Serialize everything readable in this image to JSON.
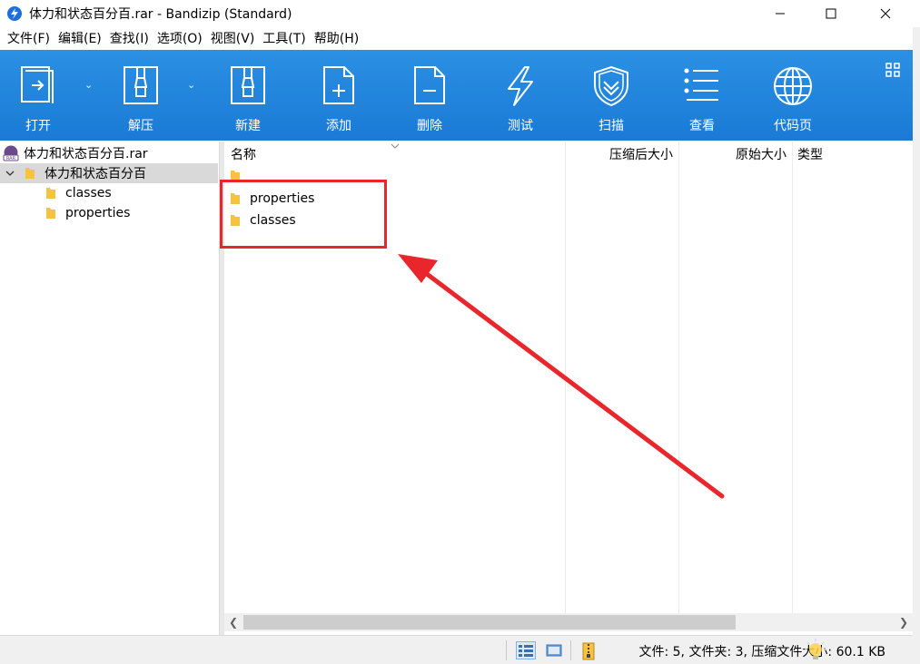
{
  "window": {
    "title": "体力和状态百分百.rar - Bandizip (Standard)"
  },
  "menu": [
    "文件(F)",
    "编辑(E)",
    "查找(I)",
    "选项(O)",
    "视图(V)",
    "工具(T)",
    "帮助(H)"
  ],
  "toolbar": {
    "open": "打开",
    "extract": "解压",
    "new": "新建",
    "add": "添加",
    "delete": "删除",
    "test": "测试",
    "scan": "扫描",
    "view": "查看",
    "codepage": "代码页"
  },
  "tree": {
    "archive": "体力和状态百分百.rar",
    "root": "体力和状态百分百",
    "children": [
      "classes",
      "properties"
    ]
  },
  "list": {
    "columns": {
      "name": "名称",
      "packed": "压缩后大小",
      "original": "原始大小",
      "type": "类型"
    },
    "rows": [
      "",
      "properties",
      "classes"
    ]
  },
  "status": {
    "text": "文件: 5, 文件夹: 3, 压缩文件大小: 60.1 KB"
  },
  "colors": {
    "toolbar": "#1a7ad6",
    "annotation": "#e8262b",
    "folder": "#f5c342"
  }
}
